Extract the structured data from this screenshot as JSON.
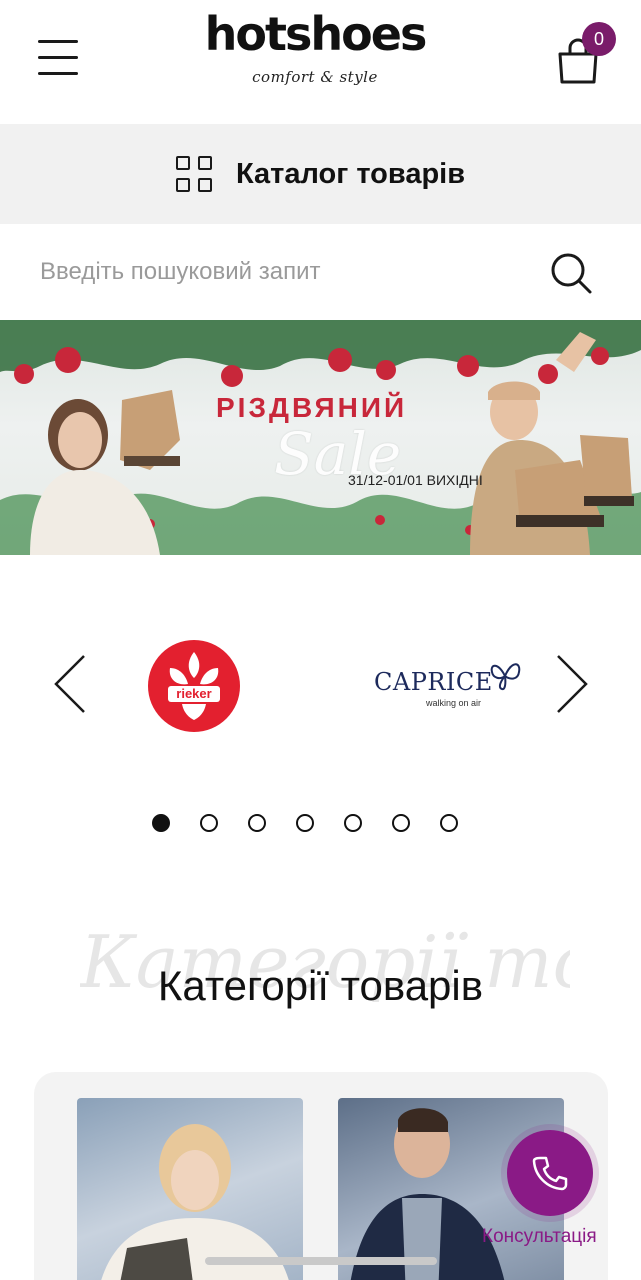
{
  "header": {
    "logo_text": "hotshoes",
    "logo_tagline": "comfort & style",
    "cart_count": "0"
  },
  "catalog": {
    "label": "Каталог товарів"
  },
  "search": {
    "placeholder": "Введіть пошуковий запит",
    "value": ""
  },
  "banner": {
    "title": "РІЗДВЯНИЙ",
    "script": "Sale",
    "dates": "31/12-01/01 ВИХІДНІ"
  },
  "brands": {
    "items": [
      {
        "name": "rieker"
      },
      {
        "name": "CAPRICE",
        "tagline": "walking on air"
      }
    ],
    "dot_count": 7,
    "active_dot": 1
  },
  "categories": {
    "script_title": "Категорії товарів",
    "title": "Категорії товарів"
  },
  "consultation": {
    "label": "Консультація"
  },
  "colors": {
    "accent": "#8a1a86",
    "banner_red": "#c8273a",
    "rieker_red": "#e3202f",
    "caprice_navy": "#1d2a5c"
  },
  "icons": {
    "menu": "menu-icon",
    "cart": "shopping-bag-icon",
    "catalog": "grid-icon",
    "search": "search-icon",
    "prev": "chevron-left-icon",
    "next": "chevron-right-icon",
    "phone": "phone-icon"
  }
}
